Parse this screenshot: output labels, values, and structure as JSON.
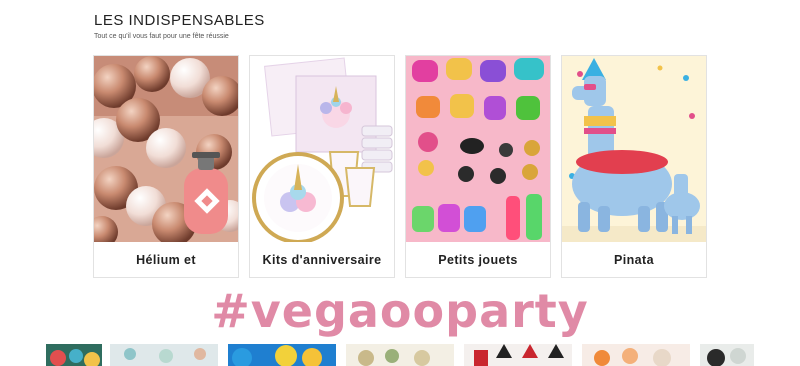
{
  "section": {
    "title": "LES INDISPENSABLES",
    "subtitle": "Tout ce qu'il vous faut pour une fête réussie"
  },
  "cards": [
    {
      "label": "Hélium et",
      "image": "rose-gold-balloons-helium-tank"
    },
    {
      "label": "Kits d'anniversaire",
      "image": "unicorn-party-plates-cups-napkins"
    },
    {
      "label": "Petits jouets",
      "image": "colorful-small-party-toys"
    },
    {
      "label": "Pinata",
      "image": "llama-pinata"
    }
  ],
  "hashtag": "#vegaooparty",
  "colors": {
    "hashtag": "#e08aa6",
    "border": "#e2e2e2"
  },
  "gallery": {
    "thumb_count": 7
  }
}
